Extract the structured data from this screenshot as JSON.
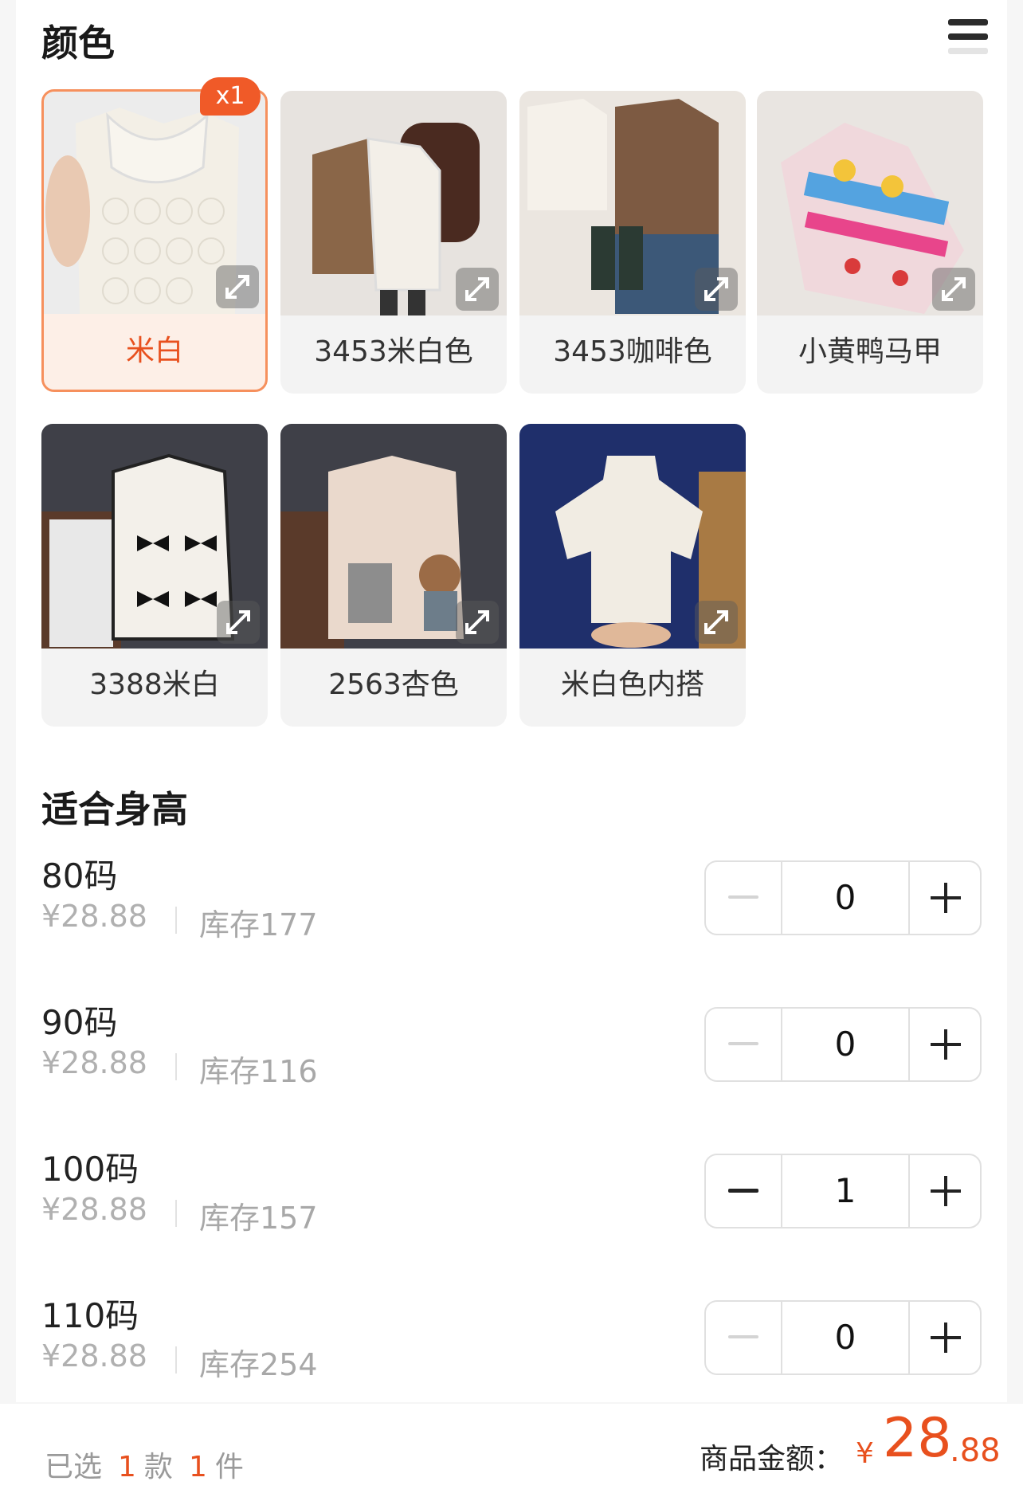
{
  "color_section": {
    "title": "颜色",
    "options": [
      {
        "label": "米白",
        "selected": true,
        "badge": "x1",
        "image": "cream quilted vest"
      },
      {
        "label": "3453米白色",
        "selected": false,
        "image": "cream ruffle vest"
      },
      {
        "label": "3453咖啡色",
        "selected": false,
        "image": "coffee ruffle vest"
      },
      {
        "label": "小黄鸭马甲",
        "selected": false,
        "image": "duck knit vest"
      },
      {
        "label": "3388米白",
        "selected": false,
        "image": "bow fleece vest"
      },
      {
        "label": "2563杏色",
        "selected": false,
        "image": "apricot bear vest"
      },
      {
        "label": "米白色内搭",
        "selected": false,
        "image": "cream turtleneck"
      }
    ]
  },
  "size_section": {
    "title": "适合身高",
    "items": [
      {
        "name": "80码",
        "price": "¥28.88",
        "stock": "库存177",
        "qty": "0",
        "minus_enabled": false
      },
      {
        "name": "90码",
        "price": "¥28.88",
        "stock": "库存116",
        "qty": "0",
        "minus_enabled": false
      },
      {
        "name": "100码",
        "price": "¥28.88",
        "stock": "库存157",
        "qty": "1",
        "minus_enabled": true
      },
      {
        "name": "110码",
        "price": "¥28.88",
        "stock": "库存254",
        "qty": "0",
        "minus_enabled": false
      }
    ]
  },
  "footer": {
    "selected_prefix": "已选",
    "style_count": "1",
    "style_unit": "款",
    "piece_count": "1",
    "piece_unit": "件",
    "total_label": "商品金额：",
    "currency": "¥",
    "amount_int": "28",
    "amount_dec": ".88"
  },
  "colors": {
    "accent": "#e8501e",
    "badge": "#f05a28",
    "selected_bg": "#fdefe7"
  }
}
